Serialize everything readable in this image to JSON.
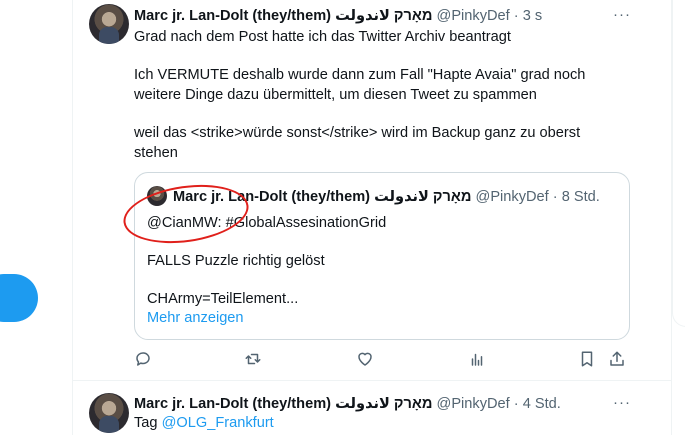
{
  "tweets": [
    {
      "author_name": "Marc jr. Lan-Dolt (they/them) מאָרק لاندولت",
      "handle": "@PinkyDef",
      "separator": "·",
      "time": "3 s",
      "paragraphs": [
        "Grad nach dem Post hatte ich das Twitter Archiv beantragt",
        "Ich VERMUTE deshalb wurde dann zum Fall \"Hapte Avaia\" grad noch weitere Dinge dazu übermittelt, um diesen Tweet zu spammen",
        "weil das <strike>würde sonst</strike> wird im Backup ganz zu oberst stehen"
      ],
      "quote": {
        "author_name": "Marc jr. Lan-Dolt (they/them) מאָרק لاندولت",
        "handle": "@PinkyDef",
        "separator": "·",
        "time": "8 Std.",
        "line1": "@CianMW: #GlobalAssesinationGrid",
        "line2": "FALLS Puzzle richtig gelöst",
        "line3": "CHArmy=TeilElement...",
        "show_more": "Mehr anzeigen"
      },
      "more_label": "···"
    },
    {
      "author_name": "Marc jr. Lan-Dolt (they/them) מאָרק لاندولت",
      "handle": "@PinkyDef",
      "separator": "·",
      "time": "4 Std.",
      "text_prefix": "Tag ",
      "mention": "@OLG_Frankfurt",
      "more_label": "···"
    }
  ],
  "icons": {
    "reply": "reply-icon",
    "retweet": "retweet-icon",
    "like": "heart-icon",
    "views": "views-icon",
    "bookmark": "bookmark-icon",
    "share": "share-icon"
  },
  "colors": {
    "accent": "#1d9bf0",
    "muted": "#536471",
    "annotation": "#e0201b"
  }
}
